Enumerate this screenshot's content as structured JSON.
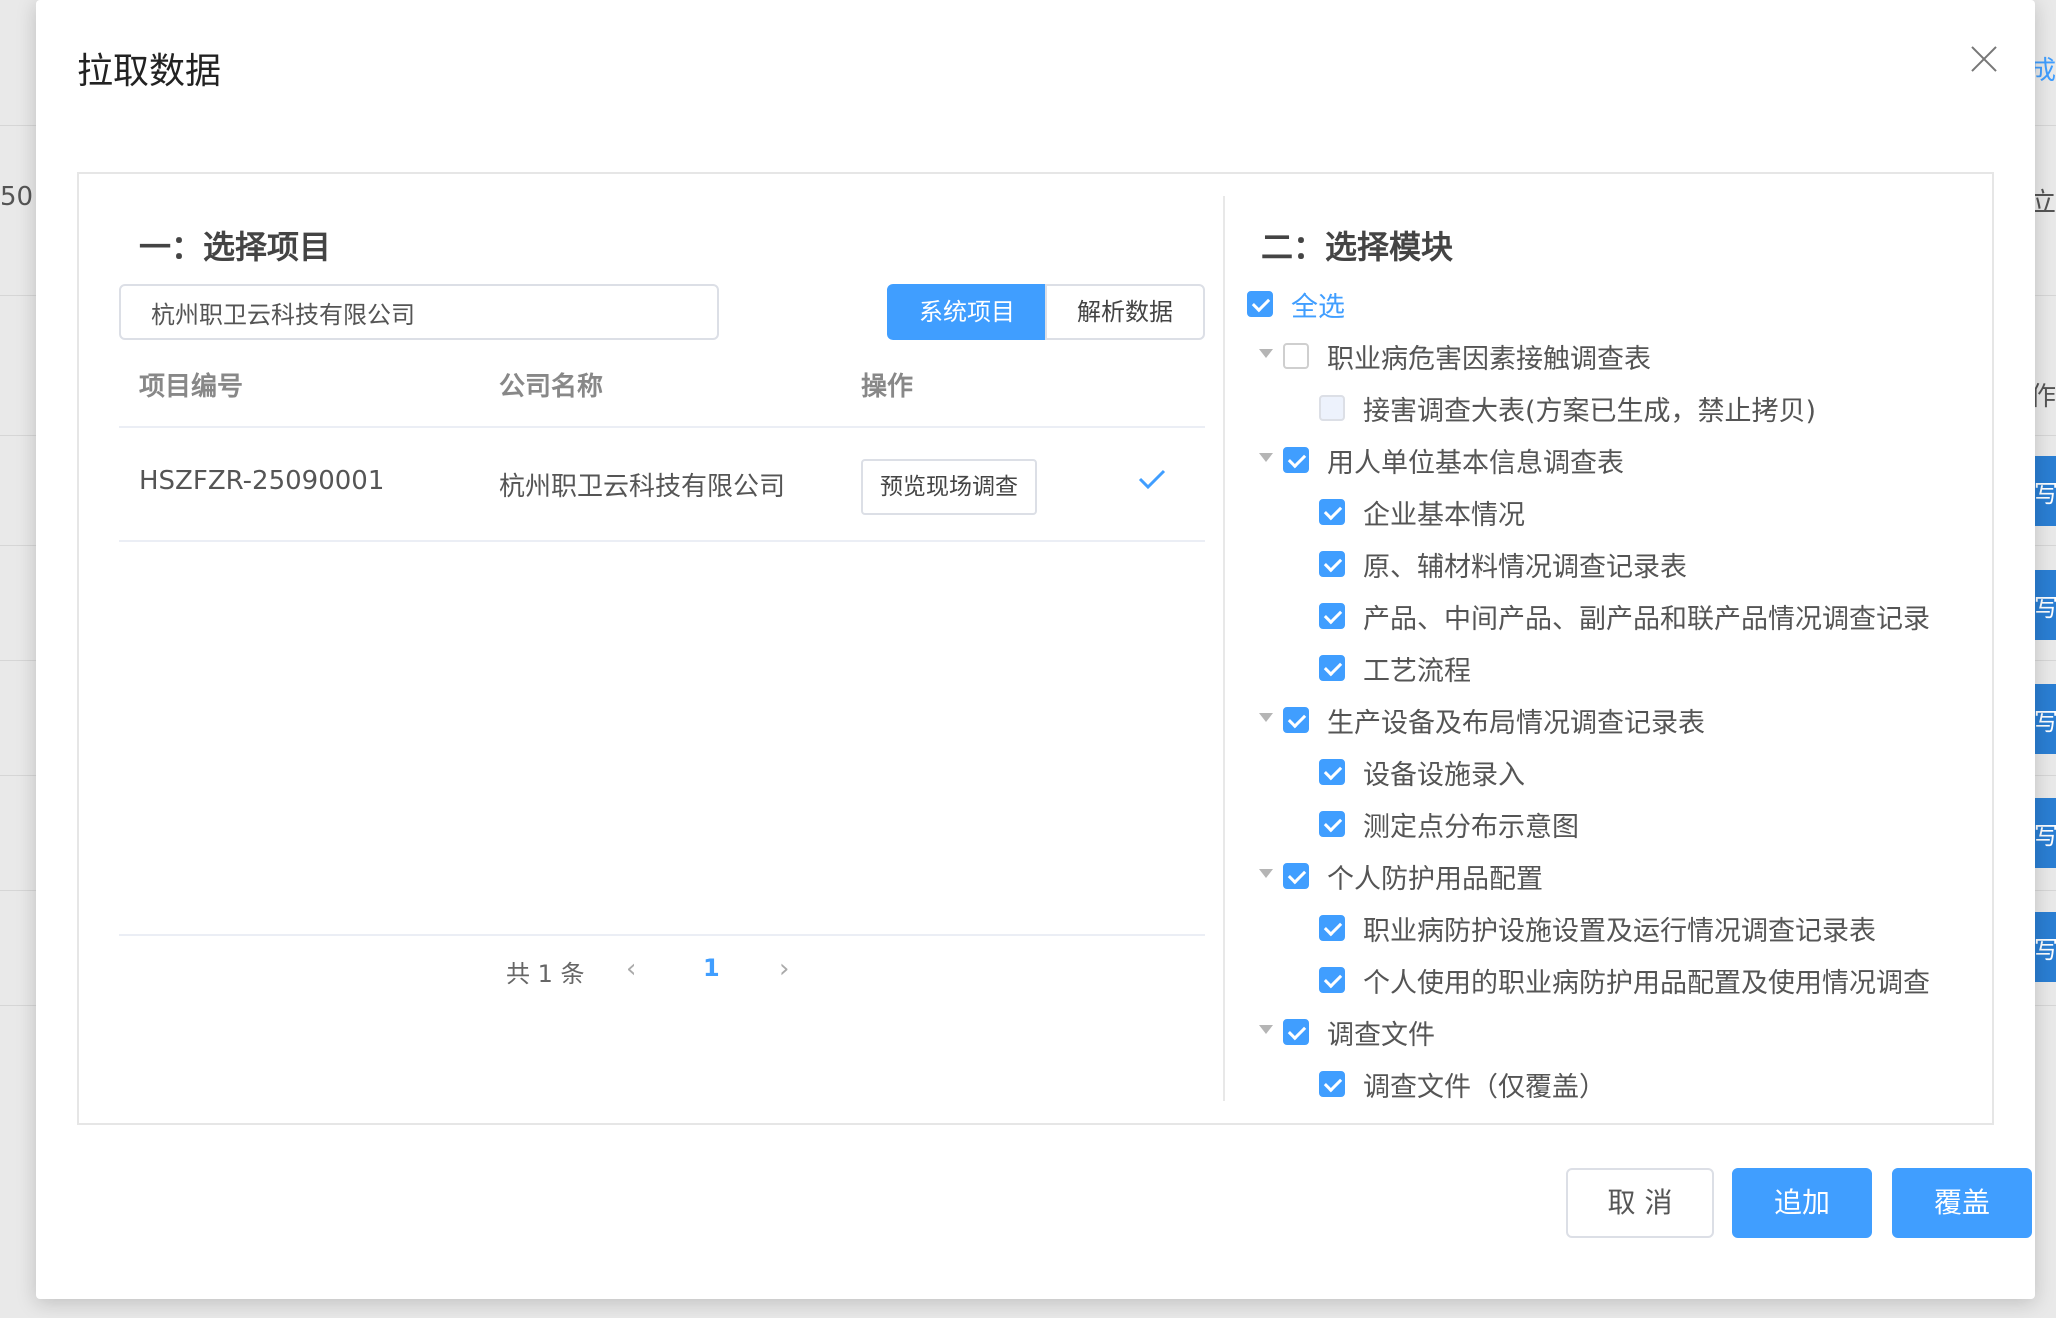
{
  "background": {
    "edge_texts": [
      "50",
      "立",
      "作",
      "成"
    ],
    "side_button_label": "写"
  },
  "dialog": {
    "title": "拉取数据"
  },
  "left": {
    "section_title": "一：选择项目",
    "search": {
      "value": "杭州职卫云科技有限公司",
      "placeholder": ""
    },
    "source_tabs": {
      "system": "系统项目",
      "parse": "解析数据"
    },
    "table": {
      "columns": [
        "项目编号",
        "公司名称",
        "操作"
      ],
      "rows": [
        {
          "project_no": "HSZFZR-25090001",
          "company": "杭州职卫云科技有限公司",
          "action": "预览现场调查",
          "selected": true
        }
      ]
    },
    "pager": {
      "total": "共 1 条",
      "current": "1"
    }
  },
  "right": {
    "section_title": "二：选择模块",
    "select_all": "全选",
    "tree": [
      {
        "label": "职业病危害因素接触调查表",
        "checked": false,
        "children": [
          {
            "label": "接害调查大表(方案已生成，禁止拷贝)",
            "checked": false,
            "disabled": true
          }
        ]
      },
      {
        "label": "用人单位基本信息调查表",
        "checked": true,
        "children": [
          {
            "label": "企业基本情况",
            "checked": true
          },
          {
            "label": "原、辅材料情况调查记录表",
            "checked": true
          },
          {
            "label": "产品、中间产品、副产品和联产品情况调查记录",
            "checked": true
          },
          {
            "label": "工艺流程",
            "checked": true
          }
        ]
      },
      {
        "label": "生产设备及布局情况调查记录表",
        "checked": true,
        "children": [
          {
            "label": "设备设施录入",
            "checked": true
          },
          {
            "label": "测定点分布示意图",
            "checked": true
          }
        ]
      },
      {
        "label": "个人防护用品配置",
        "checked": true,
        "children": [
          {
            "label": "职业病防护设施设置及运行情况调查记录表",
            "checked": true
          },
          {
            "label": "个人使用的职业病防护用品配置及使用情况调查",
            "checked": true
          }
        ]
      },
      {
        "label": "调查文件",
        "checked": true,
        "children": [
          {
            "label": "调查文件（仅覆盖）",
            "checked": true
          }
        ]
      }
    ]
  },
  "footer": {
    "cancel": "取 消",
    "append": "追加",
    "overwrite": "覆盖"
  },
  "colors": {
    "primary": "#409eff",
    "border": "#dcdfe6"
  }
}
